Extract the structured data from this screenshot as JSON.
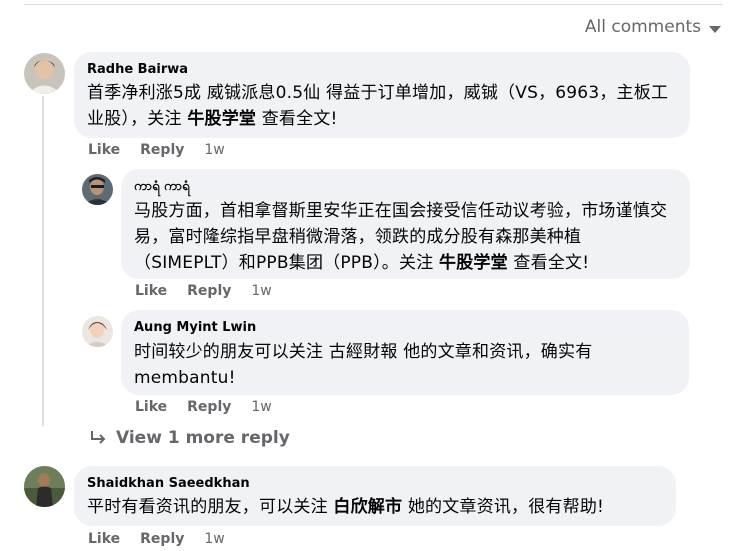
{
  "sort": {
    "label": "All comments"
  },
  "comments": [
    {
      "author": "Radhe Bairwa",
      "text_parts": [
        "首季净利涨5成 威铖派息0.5仙 得益于订单增加，威铖（VS，6963，主板工业股），关注 ",
        "牛股学堂",
        " 查看全文!"
      ],
      "like": "Like",
      "reply": "Reply",
      "time": "1w"
    },
    {
      "author": "ကာရံ ကာရံ",
      "text_parts": [
        "马股方面，首相拿督斯里安华正在国会接受信任动议考验，市场谨慎交易，富时隆综指早盘稍微滑落，领跌的成分股有森那美种植（SIMEPLT）和PPB集团（PPB）。关注 ",
        "牛股学堂",
        " 查看全文!"
      ],
      "like": "Like",
      "reply": "Reply",
      "time": "1w"
    },
    {
      "author": "Aung Myint Lwin",
      "text": "时间较少的朋友可以关注 古經財報 他的文章和资讯，确实有membantu!",
      "like": "Like",
      "reply": "Reply",
      "time": "1w"
    },
    {
      "author": "Shaidkhan Saeedkhan",
      "text_parts": [
        "平时有看资讯的朋友，可以关注 ",
        "白欣解市",
        " 她的文章资讯，很有帮助!"
      ],
      "like": "Like",
      "reply": "Reply",
      "time": "1w"
    }
  ],
  "view_more": {
    "label": "View 1 more reply"
  },
  "icons": {
    "reply_arrow": "reply-arrow-icon",
    "sort_caret": "caret-down-icon"
  }
}
